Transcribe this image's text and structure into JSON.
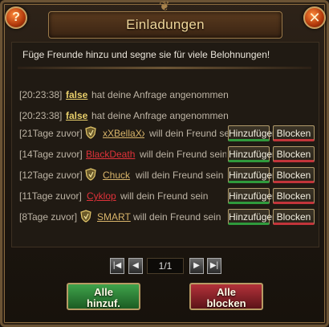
{
  "window": {
    "title": "Einladungen",
    "help_label": "?",
    "close_label": "✕"
  },
  "headline": "Füge Freunde hinzu und segne sie für viele Belohnungen!",
  "rows": [
    {
      "time": "[20:23:38]",
      "name": "false",
      "text": "hat deine Anfrage angenommen"
    },
    {
      "time": "[20:23:38]",
      "name": "false",
      "text": "hat deine Anfrage angenommen"
    },
    {
      "time": "[21Tage zuvor]",
      "name": "xXBellaXx",
      "text": "will dein Freund sein"
    },
    {
      "time": "[14Tage zuvor]",
      "name": "BlackDeath",
      "text": "will dein Freund sein"
    },
    {
      "time": "[12Tage zuvor]",
      "name": "Chuck",
      "text": "will dein Freund sein"
    },
    {
      "time": "[11Tage zuvor]",
      "name": "Cyklop",
      "text": "will dein Freund sein"
    },
    {
      "time": "[8Tage zuvor]",
      "name": "SMART",
      "text": "will dein Freund sein"
    }
  ],
  "buttons": {
    "add": "Hinzufügen",
    "block": "Blocken",
    "add_all_line1": "Alle",
    "add_all_line2": "hinzuf.",
    "block_all_line1": "Alle",
    "block_all_line2": "blocken"
  },
  "pager": {
    "first": "|◀",
    "prev": "◀",
    "next": "▶",
    "last": "▶|",
    "indicator": "1/1"
  },
  "colors": {
    "name_yellow": "#e8cf6b",
    "name_gold": "#d8b46a",
    "name_red": "#e0323a",
    "add_accent": "#2f9a3c",
    "block_accent": "#c2343a"
  }
}
